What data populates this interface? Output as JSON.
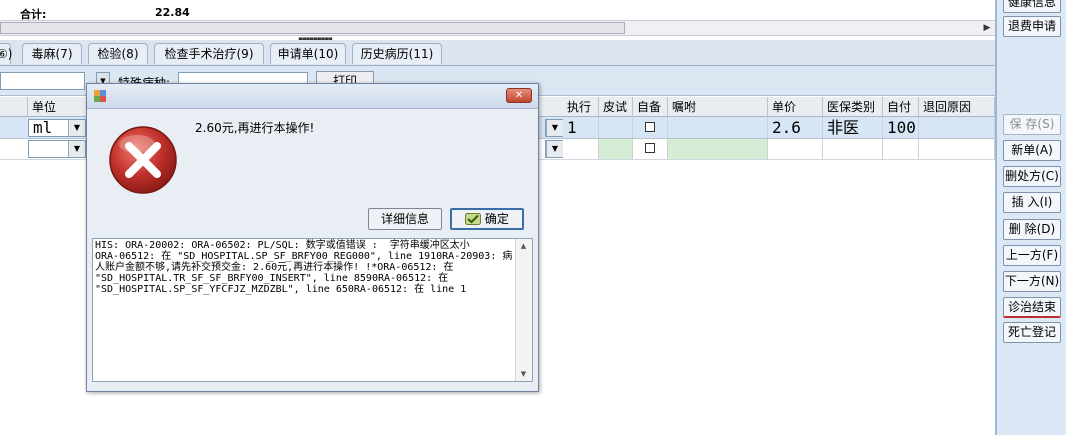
{
  "summary": {
    "label": "合计:",
    "value": "22.84"
  },
  "tabs": [
    {
      "label": "⑥)"
    },
    {
      "label": "毒麻(7)"
    },
    {
      "label": "检验(8)"
    },
    {
      "label": "检查手术治疗(9)"
    },
    {
      "label": "申请单(10)"
    },
    {
      "label": "历史病历(11)"
    }
  ],
  "toolbar": {
    "filter_label": "特殊病种:",
    "print_label": "打印"
  },
  "grid": {
    "columns": {
      "unit": "单位",
      "exec": "执行",
      "skin": "皮试",
      "self": "自备",
      "advice": "嘱咐",
      "price": "单价",
      "insurance": "医保类别",
      "selfpay": "自付",
      "refund": "退回原因"
    },
    "rows": [
      {
        "unit": "ml",
        "exec": "1",
        "price": "2.6",
        "insurance": "非医",
        "selfpay": "100"
      }
    ]
  },
  "right_panel": {
    "health_info": "健康信息",
    "refund_apply": "退费申请",
    "save": "保 存(S)",
    "new_order": "新单(A)",
    "delete_rx": "删处方(C)",
    "insert": "插 入(I)",
    "delete": "删 除(D)",
    "prev": "上一方(F)",
    "next": "下一方(N)",
    "end_treatment": "诊治结束",
    "death_register": "死亡登记"
  },
  "dialog": {
    "message": "2.60元,再进行本操作!",
    "detail_button": "详细信息",
    "ok_button": "确定",
    "detail_text": "HIS: ORA-20002: ORA-06502: PL/SQL: 数字或值错误 :  字符串缓冲区太小\nORA-06512: 在 \"SD_HOSPITAL.SP_SF_BRFY00_REG000\", line 1910RA-20903: 病人账户金额不够,请先补交预交金: 2.60元,再进行本操作! !*ORA-06512: 在\n\"SD_HOSPITAL.TR_SF_SF_BRFY00_INSERT\", line 8590RA-06512: 在\n\"SD_HOSPITAL.SP_SF_YFCFJZ_MZDZBL\", line 650RA-06512: 在 line 1"
  },
  "colors": {
    "accent_red": "#c0302a",
    "panel_bg": "#dce8f5",
    "row_selected": "#d7e6f5",
    "row_green": "#d4edd4"
  }
}
